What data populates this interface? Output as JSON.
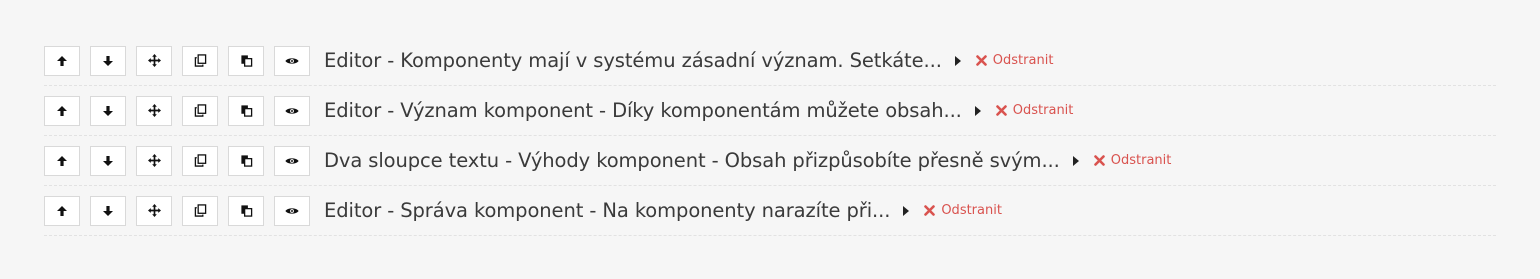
{
  "components": [
    {
      "title": "Editor - Komponenty mají v systému zásadní význam. Setkáte...",
      "remove_label": "Odstranit"
    },
    {
      "title": "Editor - Význam komponent - Díky komponentám můžete obsah...",
      "remove_label": "Odstranit"
    },
    {
      "title": "Dva sloupce textu - Výhody komponent - Obsah přizpůsobíte přesně svým...",
      "remove_label": "Odstranit"
    },
    {
      "title": "Editor - Správa komponent - Na komponenty narazíte při...",
      "remove_label": "Odstranit"
    }
  ],
  "icons": {
    "move_up": "arrow-up-icon",
    "move_down": "arrow-down-icon",
    "drag": "move-icon",
    "copy": "copy-icon",
    "paste": "paste-icon",
    "preview": "eye-icon",
    "expand": "caret-right-icon",
    "remove": "close-icon"
  },
  "colors": {
    "background": "#f6f6f6",
    "title_text": "#3a3a3a",
    "remove_accent": "#d9534f",
    "button_border": "#d9d9d9"
  }
}
